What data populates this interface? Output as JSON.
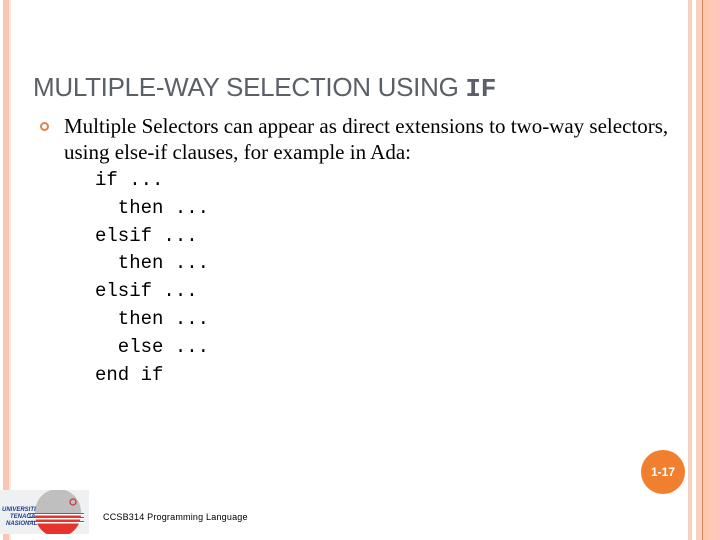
{
  "slide": {
    "title_text": "MULTIPLE-WAY SELECTION USING ",
    "title_code": "IF",
    "bullet_text": "Multiple Selectors can appear as direct extensions to two-way selectors, using else-if clauses, for example in Ada:",
    "code_lines": [
      "if ...",
      "  then ...",
      "elsif ...",
      "  then ...",
      "elsif ...",
      "  then ...",
      "  else ...",
      "end if"
    ],
    "page_number": "1-17"
  },
  "footer": {
    "course": "CCSB314 Programming Language",
    "logo_lines": [
      "UNIVERSITI",
      "TENAGA",
      "NASIONAL"
    ]
  },
  "colors": {
    "accent": "#f08030",
    "border": "#f9c6b3",
    "title": "#5b6068"
  }
}
